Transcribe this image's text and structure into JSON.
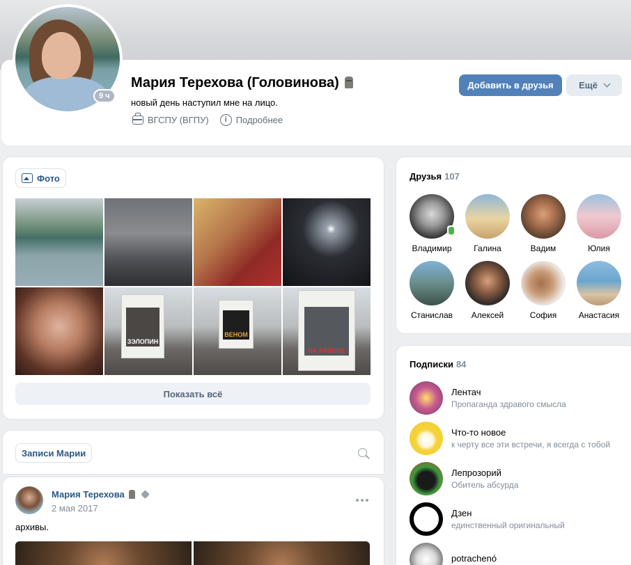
{
  "profile": {
    "name": "Мария Терехова (Головинова)",
    "status": "новый день наступил мне на лицо.",
    "online_badge": "9 ч",
    "education": "ВГСПУ (ВГПУ)",
    "details_label": "Подробнее",
    "add_friend_label": "Добавить в друзья",
    "more_label": "Ещё"
  },
  "photos": {
    "tab_label": "Фото",
    "show_all_label": "Показать всё",
    "poster_labels": [
      "ЗЭЛОПИН",
      "ВЕНОМ",
      "НА РАЙОНЕ"
    ]
  },
  "wall": {
    "tab_label": "Записи Марии",
    "post": {
      "author": "Мария Терехова",
      "date": "2 мая 2017",
      "text": "архивы."
    }
  },
  "friends": {
    "title": "Друзья",
    "count": "107",
    "items": [
      {
        "name": "Владимир",
        "online": true
      },
      {
        "name": "Галина"
      },
      {
        "name": "Вадим"
      },
      {
        "name": "Юлия"
      },
      {
        "name": "Станислав"
      },
      {
        "name": "Алексей"
      },
      {
        "name": "София"
      },
      {
        "name": "Анастасия"
      }
    ]
  },
  "subscriptions": {
    "title": "Подписки",
    "count": "84",
    "items": [
      {
        "name": "Лентач",
        "desc": "Пропаганда здравого смысла"
      },
      {
        "name": "Что-то новое",
        "desc": "к черту все эти встречи, я всегда с тобой"
      },
      {
        "name": "Лепрозорий",
        "desc": "Обитель абсурда"
      },
      {
        "name": "Дзен",
        "desc": "единственный оригинальный"
      },
      {
        "name": "potrachenó",
        "desc": ""
      }
    ]
  },
  "colors": {
    "accent": "#5181b8",
    "link": "#2a5885",
    "secondary_text": "#818c99",
    "background": "#edeef0",
    "online": "#4bb34b"
  }
}
